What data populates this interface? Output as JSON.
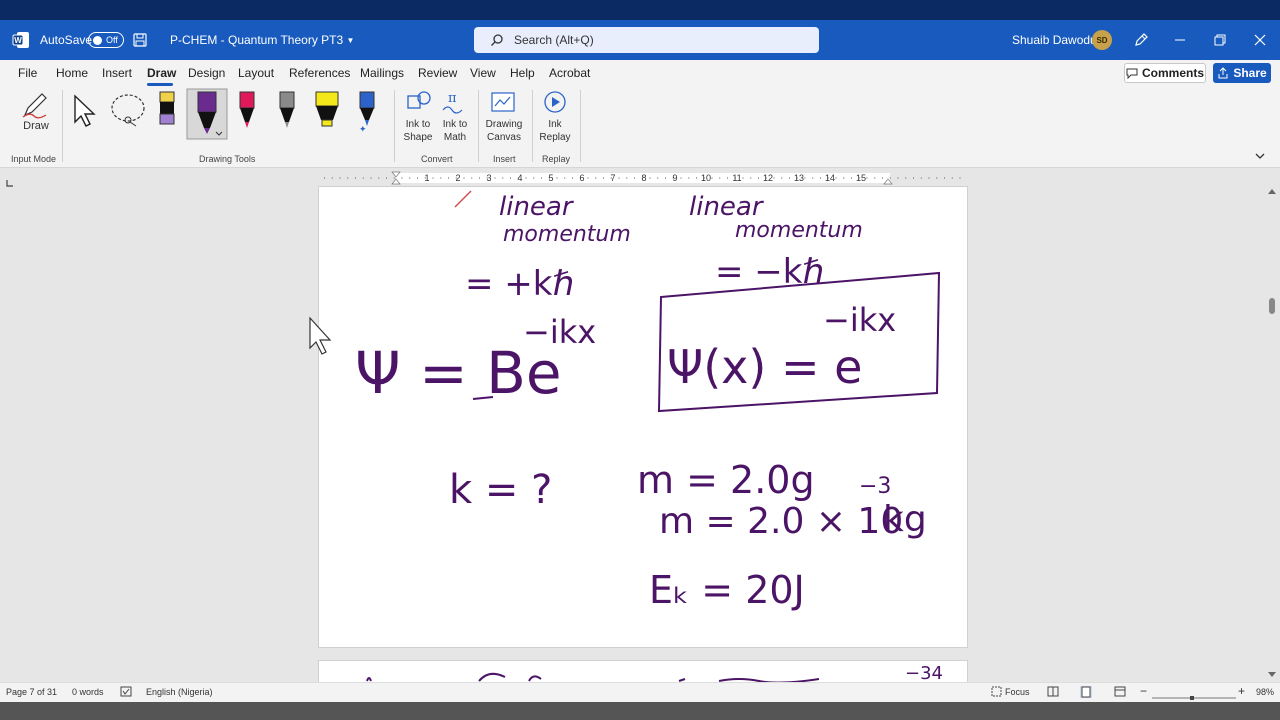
{
  "titlebar": {
    "autosave_label": "AutoSave",
    "autosave_state": "Off",
    "doc_title": "P-CHEM - Quantum Theory PT3",
    "search_placeholder": "Search (Alt+Q)",
    "user_name": "Shuaib Dawodu",
    "user_initials": "SD"
  },
  "menu": {
    "items": [
      "File",
      "Home",
      "Insert",
      "Draw",
      "Design",
      "Layout",
      "References",
      "Mailings",
      "Review",
      "View",
      "Help",
      "Acrobat"
    ],
    "comments_label": "Comments",
    "share_label": "Share"
  },
  "ribbon": {
    "draw_label": "Draw",
    "input_mode_label": "Input Mode",
    "drawing_tools_label": "Drawing Tools",
    "ink_to_shape": [
      "Ink to",
      "Shape"
    ],
    "ink_to_math": [
      "Ink to",
      "Math"
    ],
    "convert_label": "Convert",
    "drawing_canvas": [
      "Drawing",
      "Canvas"
    ],
    "insert_label": "Insert",
    "ink_replay": [
      "Ink",
      "Replay"
    ],
    "replay_label": "Replay",
    "pen_colors": [
      "#f0d24a",
      "#6a2b8f",
      "#e0195b",
      "#8a8a8a",
      "#f4e81b",
      "#2b63c8"
    ]
  },
  "ruler": {
    "numbers": [
      "1",
      "2",
      "3",
      "4",
      "5",
      "6",
      "7",
      "8",
      "9",
      "10",
      "11",
      "12",
      "13",
      "14",
      "15"
    ]
  },
  "ink": {
    "l1": "linear",
    "l2": "momentum",
    "l3": "= +kℏ",
    "r1": "linear",
    "r2": "momentum",
    "r3": "= −kℏ",
    "psi_left_base": "Ψ = Be",
    "psi_left_exp": "−ikx",
    "psi_right_base": "Ψ(x) = e",
    "psi_right_exp": "−ikx",
    "k_question": "k = ?",
    "m1": "m = 2.0g",
    "m2_base": "m = 2.0 × 10",
    "m2_exp": "−3",
    "m2_unit": "kg",
    "ek": "Eₖ = 20J",
    "page2_partial": "−34",
    "ink_color": "#4b1466"
  },
  "status": {
    "page": "Page 7 of 31",
    "words": "0 words",
    "language": "English (Nigeria)",
    "focus": "Focus",
    "zoom": "98%"
  }
}
